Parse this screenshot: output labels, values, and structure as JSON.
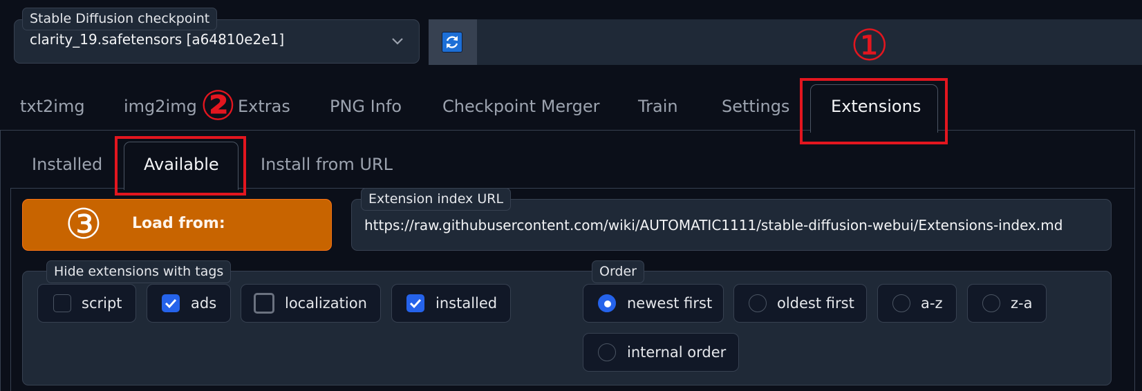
{
  "checkpoint": {
    "label": "Stable Diffusion checkpoint",
    "value": "clarity_19.safetensors [a64810e2e1]",
    "refresh_icon": "refresh-icon"
  },
  "main_tabs": [
    "txt2img",
    "img2img",
    "Extras",
    "PNG Info",
    "Checkpoint Merger",
    "Train",
    "Settings",
    "Extensions"
  ],
  "active_main_tab": "Extensions",
  "sub_tabs": [
    "Installed",
    "Available",
    "Install from URL"
  ],
  "active_sub_tab": "Available",
  "load_button": "Load from:",
  "index_url": {
    "label": "Extension index URL",
    "value": "https://raw.githubusercontent.com/wiki/AUTOMATIC1111/stable-diffusion-webui/Extensions-index.md"
  },
  "hide_tags": {
    "label": "Hide extensions with tags",
    "options": [
      {
        "label": "script",
        "checked": false
      },
      {
        "label": "ads",
        "checked": true
      },
      {
        "label": "localization",
        "checked": false
      },
      {
        "label": "installed",
        "checked": true
      }
    ]
  },
  "order": {
    "label": "Order",
    "options": [
      "newest first",
      "oldest first",
      "a-z",
      "z-a",
      "internal order"
    ],
    "selected": "newest first"
  },
  "annotations": [
    "①",
    "②",
    "③"
  ],
  "colors": {
    "background": "#0b0f19",
    "panel": "#1f2937",
    "accent_orange": "#c86400",
    "checkbox_blue": "#2563eb",
    "annotation_red": "#e3161f"
  }
}
